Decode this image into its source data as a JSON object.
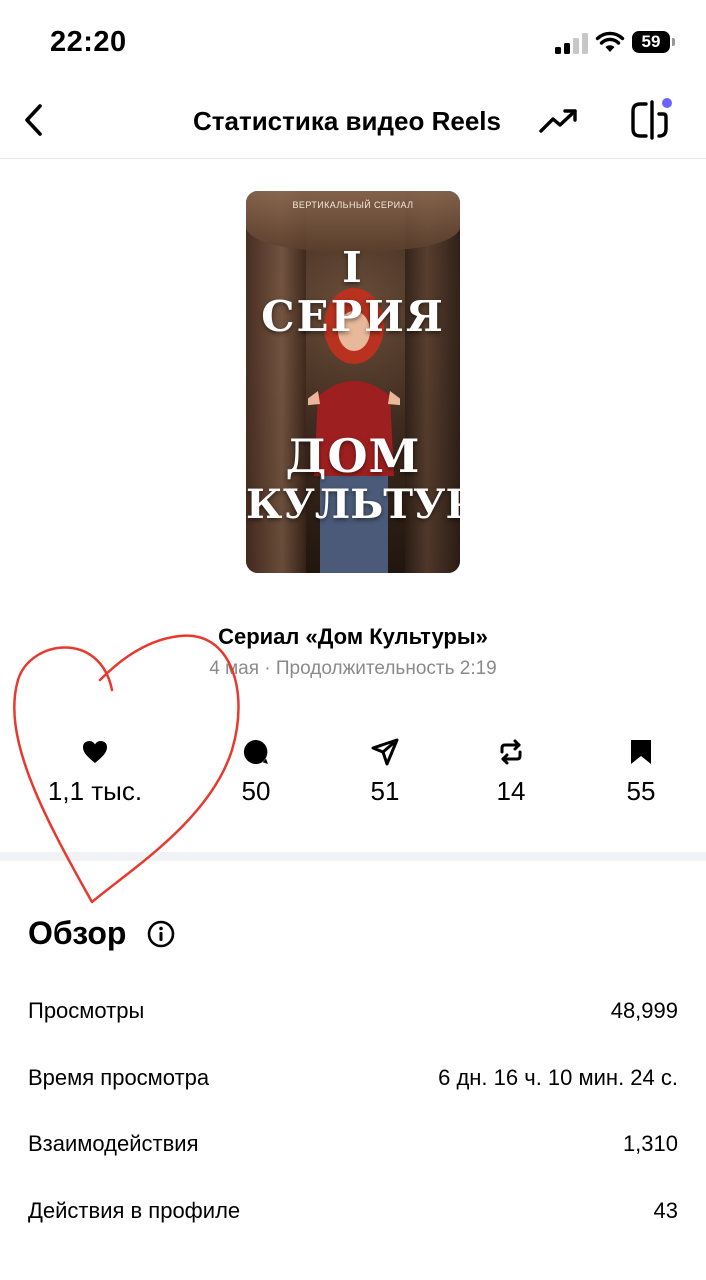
{
  "status_bar": {
    "time": "22:20",
    "battery": "59"
  },
  "nav": {
    "title": "Статистика видео Reels"
  },
  "thumbnail": {
    "subtitle": "ВЕРТИКАЛЬНЫЙ СЕРИАЛ",
    "episode": "I СЕРИЯ",
    "title_line1": "ДОМ",
    "title_line2": "КУЛЬТУРЫ"
  },
  "video": {
    "title": "Сериал «Дом Культуры»",
    "meta": "4 мая · Продолжительность 2:19"
  },
  "engagement": [
    {
      "icon": "heart-icon",
      "value": "1,1 тыс."
    },
    {
      "icon": "comment-icon",
      "value": "50"
    },
    {
      "icon": "share-icon",
      "value": "51"
    },
    {
      "icon": "repost-icon",
      "value": "14"
    },
    {
      "icon": "bookmark-icon",
      "value": "55"
    }
  ],
  "overview": {
    "title": "Обзор",
    "rows": [
      {
        "label": "Просмотры",
        "value": "48,999"
      },
      {
        "label": "Время просмотра",
        "value": "6 дн. 16 ч. 10 мин. 24 с."
      },
      {
        "label": "Взаимодействия",
        "value": "1,310"
      },
      {
        "label": "Действия в профиле",
        "value": "43"
      }
    ]
  },
  "colors": {
    "annotation": "#e8392f",
    "muted_text": "#8a8a8a",
    "divider": "#f0f2f4",
    "accent_dot": "#6c63ff"
  }
}
